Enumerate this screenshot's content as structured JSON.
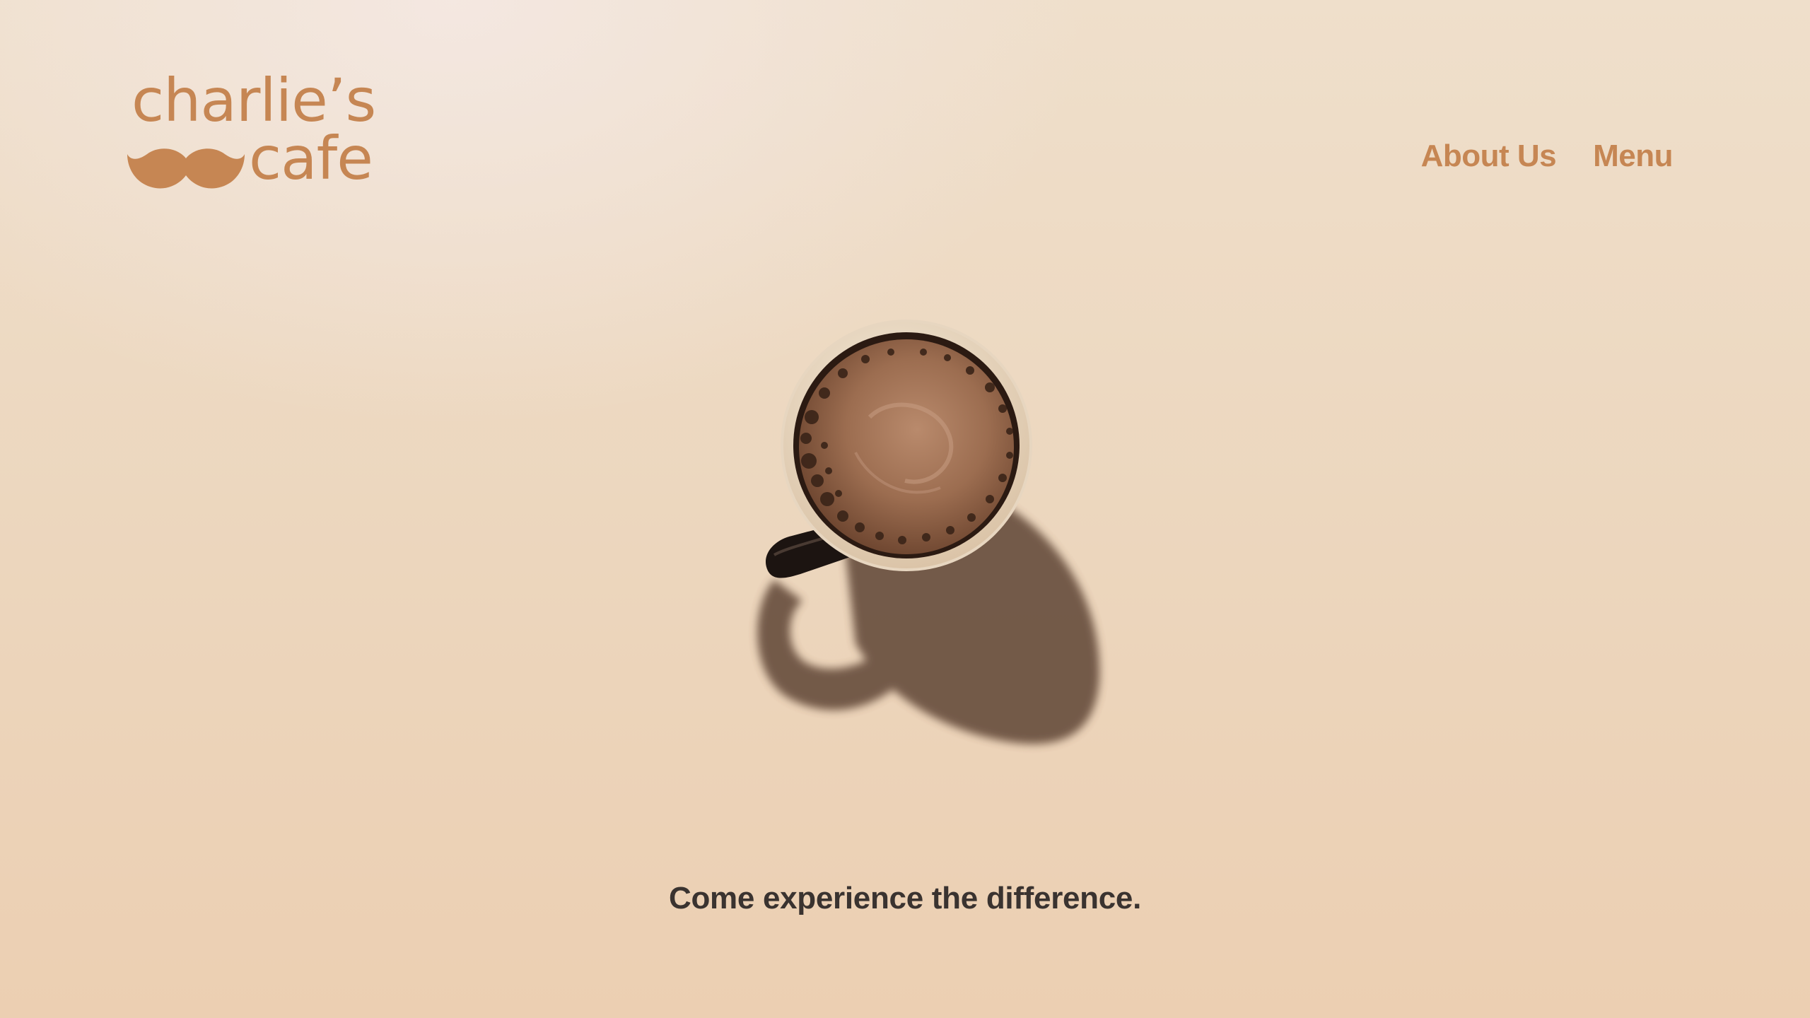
{
  "brand": {
    "logo_line1": "charlie’s",
    "logo_line2": "cafe",
    "logo_color": "#c68653"
  },
  "nav": {
    "items": [
      {
        "label": "About Us"
      },
      {
        "label": "Menu"
      }
    ]
  },
  "hero": {
    "image": "coffee-cup-top-view",
    "tagline": "Come experience the difference."
  },
  "colors": {
    "background": "#ecd6bd",
    "accent": "#c68653",
    "text": "#3a3330"
  }
}
